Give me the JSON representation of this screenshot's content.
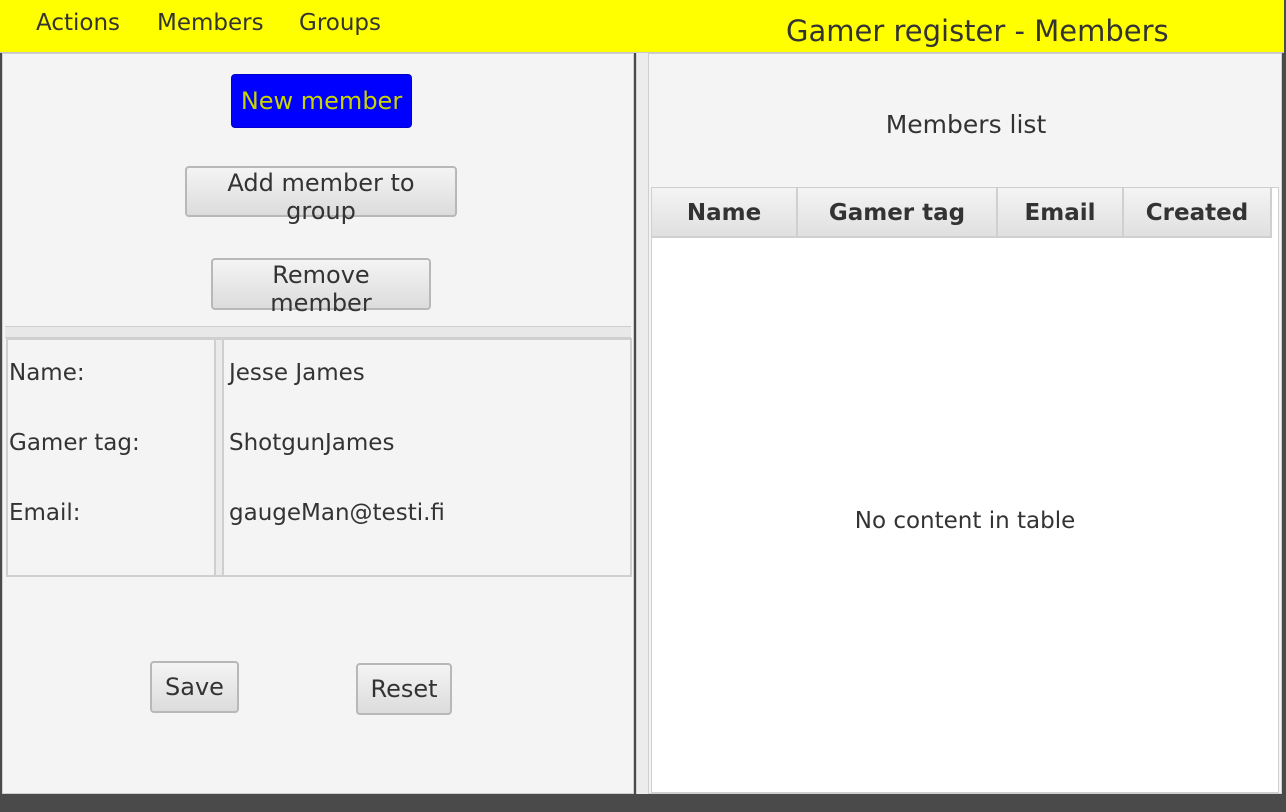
{
  "menu": {
    "items": [
      "Actions",
      "Members",
      "Groups"
    ]
  },
  "app": {
    "title": "Gamer register - Members"
  },
  "actions": {
    "new_member": "New member",
    "add_to_group": "Add member to group",
    "remove_member": "Remove member"
  },
  "details": {
    "rows": [
      {
        "label": "Name:",
        "value": "Jesse James"
      },
      {
        "label": "Gamer tag:",
        "value": "ShotgunJames"
      },
      {
        "label": "Email:",
        "value": "gaugeMan@testi.fi"
      }
    ]
  },
  "form": {
    "save": "Save",
    "reset": "Reset"
  },
  "list": {
    "title": "Members list",
    "columns": [
      "Name",
      "Gamer tag",
      "Email",
      "Created"
    ],
    "rows": [],
    "placeholder": "No content in table"
  },
  "colors": {
    "top_bar": "#ffff00",
    "primary_button_bg": "#0000ff",
    "primary_button_text": "#c8d400"
  }
}
